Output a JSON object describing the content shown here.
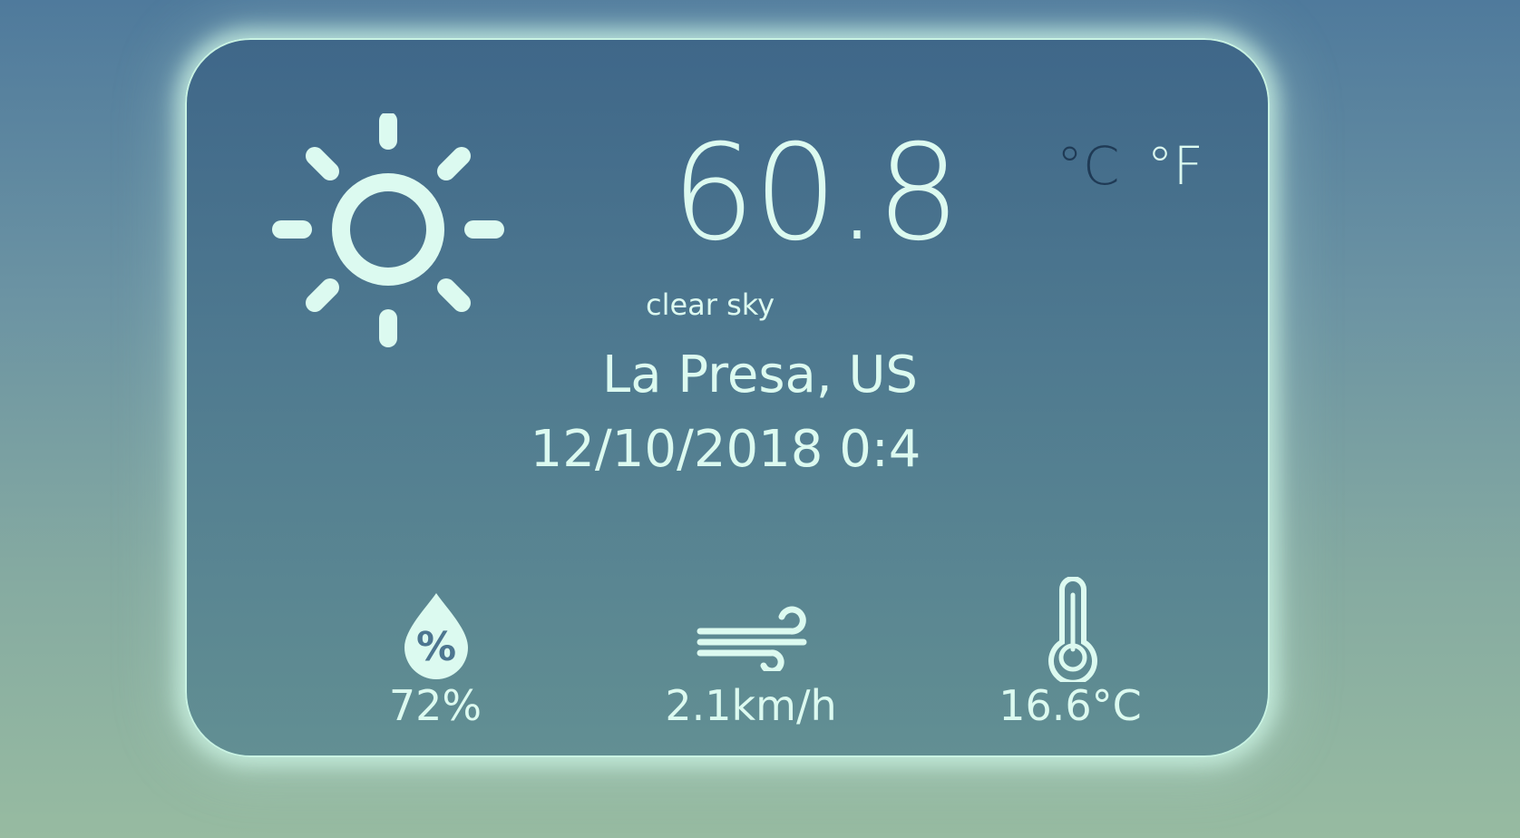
{
  "weather": {
    "icon": "sun-icon",
    "temperature": "60.8",
    "description": "clear sky",
    "location": "La Presa, US",
    "datetime": "12/10/2018 0:4"
  },
  "units": {
    "celsius_label": "°C",
    "fahrenheit_label": "°F",
    "active": "fahrenheit"
  },
  "stats": {
    "humidity": {
      "icon": "humidity-icon",
      "value": "72%"
    },
    "wind": {
      "icon": "wind-icon",
      "value": "2.1km/h"
    },
    "feels": {
      "icon": "thermometer-icon",
      "value": "16.6°C"
    }
  },
  "colors": {
    "text": "#dcfaf0",
    "inactive_unit": "#1f3a55",
    "glow": "#c9f3e3",
    "card_top": "#3f6789",
    "card_bottom": "#628f93"
  }
}
